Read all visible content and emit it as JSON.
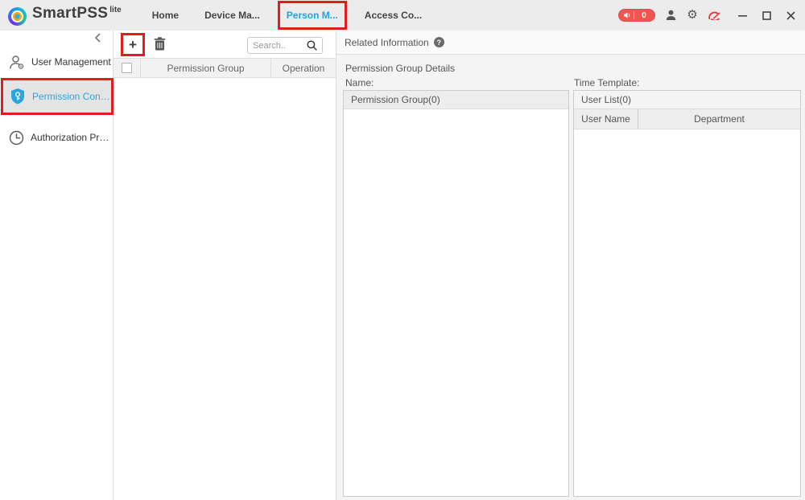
{
  "titlebar": {
    "logo_text": "SmartPSS",
    "logo_suffix": "lite",
    "tabs": [
      {
        "label": "Home",
        "active": false
      },
      {
        "label": "Device Ma...",
        "active": false
      },
      {
        "label": "Person M...",
        "active": true
      },
      {
        "label": "Access Co...",
        "active": false
      }
    ],
    "alarm": {
      "count": "0"
    }
  },
  "icons": {
    "gear_glyph": "⚙",
    "plus_glyph": "+",
    "help_glyph": "?"
  },
  "sidebar": {
    "items": [
      {
        "label": "User Management",
        "active": false
      },
      {
        "label": "Permission Confi...",
        "active": true
      },
      {
        "label": "Authorization Pro...",
        "active": false
      }
    ]
  },
  "toolbar": {
    "search_placeholder": "Search.."
  },
  "group_table": {
    "columns": [
      "Permission Group",
      "Operation"
    ],
    "rows": []
  },
  "related": {
    "title": "Related Information",
    "section_title": "Permission Group Details",
    "name_label": "Name:",
    "time_template_label": "Time Template:",
    "group_list_header": "Permission Group(0)",
    "user_list_header": "User List(0)",
    "user_table_columns": [
      "User Name",
      "Department"
    ],
    "user_rows": []
  },
  "colors": {
    "accent_blue": "#1ba4e8",
    "highlight_red": "#e11c1c",
    "alarm_red": "#ef5552",
    "titlebar_bg": "#ececec",
    "panel_bg": "#f4f4f4"
  }
}
